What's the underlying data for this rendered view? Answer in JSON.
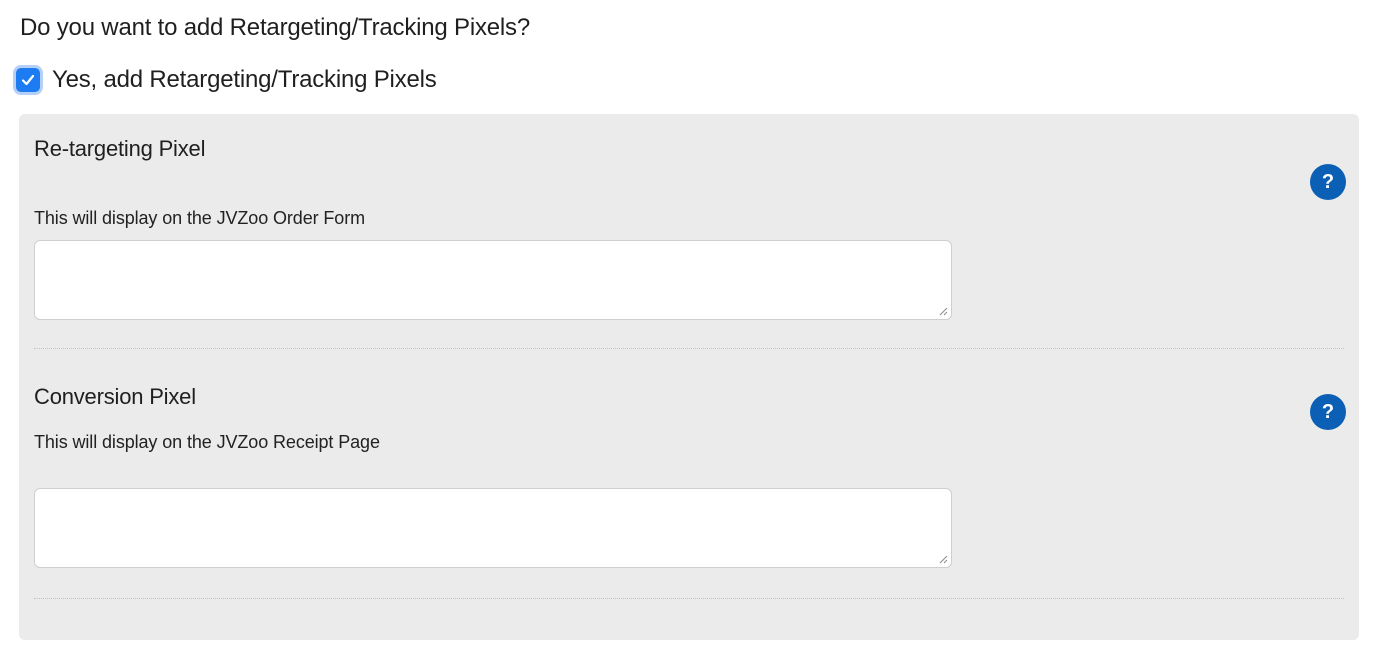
{
  "question": "Do you want to add Retargeting/Tracking Pixels?",
  "checkbox": {
    "label": "Yes, add Retargeting/Tracking Pixels",
    "checked": true,
    "color": "#1d7cf2"
  },
  "sections": [
    {
      "title": "Re-targeting Pixel",
      "subtitle": "This will display on the JVZoo Order Form",
      "help_glyph": "?",
      "textarea_value": ""
    },
    {
      "title": "Conversion Pixel",
      "subtitle": "This will display on the JVZoo Receipt Page",
      "help_glyph": "?",
      "textarea_value": ""
    }
  ],
  "colors": {
    "panel_bg": "#ebebeb",
    "help_icon_bg": "#0b5fb4"
  },
  "icons": {
    "checkbox_check": "check-icon",
    "help": "question-mark-icon",
    "resize": "resize-grip-icon"
  }
}
